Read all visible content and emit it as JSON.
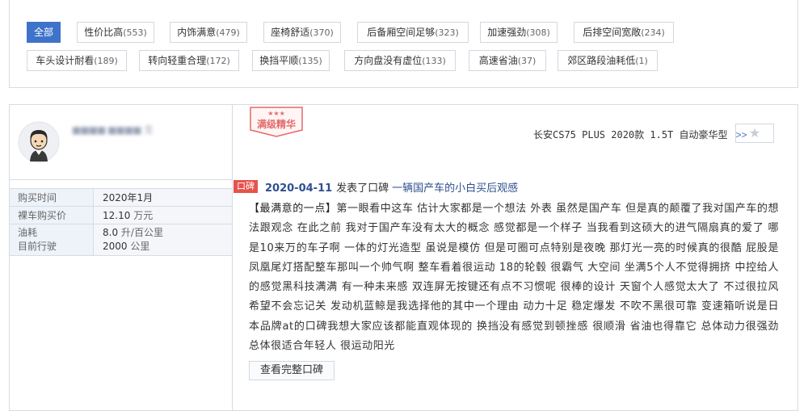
{
  "tags": [
    {
      "label": "全部",
      "count": "",
      "active": true
    },
    {
      "label": "性价比高",
      "count": "(553)"
    },
    {
      "label": "内饰满意",
      "count": "(479)"
    },
    {
      "label": "座椅舒适",
      "count": "(370)"
    },
    {
      "label": "后备厢空间足够",
      "count": "(323)"
    },
    {
      "label": "加速强劲",
      "count": "(308)"
    },
    {
      "label": "后排空间宽敞",
      "count": "(234)"
    },
    {
      "label": "车头设计耐看",
      "count": "(189)"
    },
    {
      "label": "转向轻重合理",
      "count": "(172)"
    },
    {
      "label": "换挡平顺",
      "count": "(135)"
    },
    {
      "label": "方向盘没有虚位",
      "count": "(133)"
    },
    {
      "label": "高速省油",
      "count": "(37)"
    },
    {
      "label": "郊区路段油耗低",
      "count": "(1)"
    }
  ],
  "user": {
    "name": "■■■■ ■■■■ 戈"
  },
  "info": {
    "purchase_time_label": "购买时间",
    "purchase_time": "2020年1月",
    "price_label": "裸车购买价",
    "price_value": "12.10",
    "price_unit": "万元",
    "fuel_label": "油耗",
    "fuel_value": "8.0",
    "fuel_unit": "升/百公里",
    "mileage_label": "目前行驶",
    "mileage_value": "2000",
    "mileage_unit": "公里"
  },
  "stamp": {
    "text": "满级精华",
    "stars": "★★★"
  },
  "car": {
    "model": "长安CS75 PLUS 2020款 1.5T 自动豪华型",
    "arrows": ">>"
  },
  "star_button": {
    "glyph": "★"
  },
  "review": {
    "badge": "口碑",
    "date": "2020-04-11",
    "action": "发表了口碑",
    "headline": "一辆国产车的小白买后观感",
    "section_label": "【最满意的一点】",
    "body": "第一眼看中这车 估计大家都是一个想法 外表 虽然是国产车 但是真的颠覆了我对国产车的想法跟观念 在此之前 我对于国产车没有太大的概念 感觉都是一个样子 当我看到这硕大的进气隔扇真的爱了 哪是10来万的车子啊 一体的灯光造型 虽说是模仿 但是可圈可点特别是夜晚 那灯光一亮的时候真的很酷 屁股是凤凰尾灯搭配整车那叫一个帅气啊 整车看着很运动 18的轮毂 很霸气 大空间 坐满5个人不觉得拥挤 中控给人的感觉黑科技满满 有一种未来感 双连屏无按键还有点不习惯呢 很棒的设计 天窗个人感觉太大了 不过很拉风 希望不会忘记关 发动机蓝鲸是我选择他的其中一个理由 动力十足 稳定爆发 不吹不黑很可靠 变速箱听说是日本品牌at的口碑我想大家应该都能直观体现的 换挡没有感觉到顿挫感 很顺滑 省油也得靠它 总体动力很强劲 总体很适合年轻人 很运动阳光",
    "more_button": "查看完整口碑"
  },
  "colors": {
    "accent": "#3f72c9",
    "badge": "#e5534b",
    "stamp": "#e36a6a"
  }
}
